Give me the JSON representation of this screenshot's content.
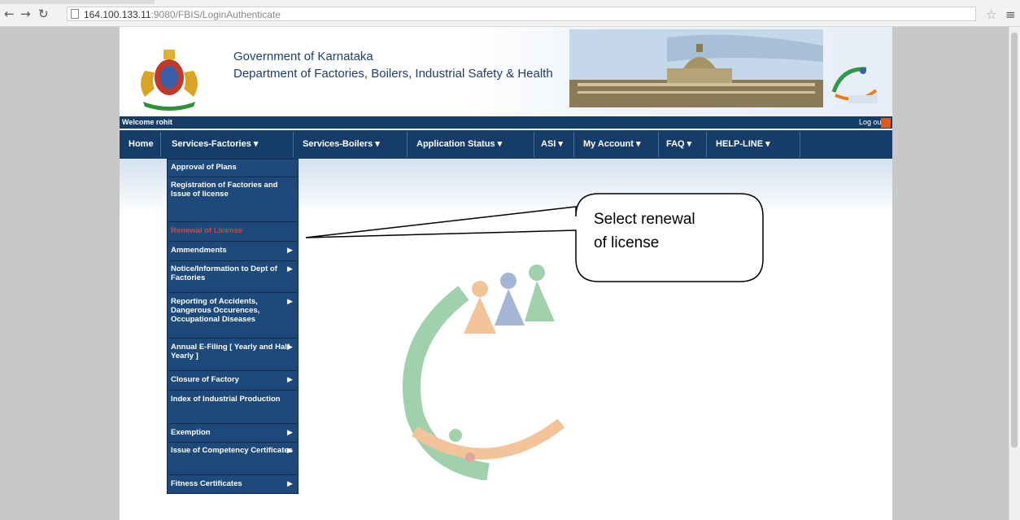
{
  "browser": {
    "url_host": "164.100.133.11",
    "url_path": ":9080/FBIS/LoginAuthenticate"
  },
  "header": {
    "gov_title": "Government of Karnataka",
    "dept_title": "Department of Factories, Boilers, Industrial Safety & Health"
  },
  "welcome": {
    "text": "Welcome rohit",
    "logout": "Log out"
  },
  "nav": {
    "home": "Home",
    "services_factories": "Services-Factories ▾",
    "services_boilers": "Services-Boilers ▾",
    "application_status": "Application Status ▾",
    "asi": "ASI ▾",
    "my_account": "My Account ▾",
    "faq": "FAQ ▾",
    "helpline": "HELP-LINE ▾"
  },
  "dropdown": {
    "approval": "Approval of Plans",
    "registration": "Registration of Factories and Issue of license",
    "renewal": "Renewal of License",
    "ammendments": "Ammendments",
    "notice": "Notice/Information to Dept of Factories",
    "reporting": "Reporting of Accidents, Dangerous Occurences, Occupational Diseases",
    "annual": "Annual E-Filing [ Yearly and Half-Yearly ]",
    "closure": "Closure of Factory",
    "index": "Index of Industrial Production",
    "exemption": "Exemption",
    "competency": "Issue of Competency Certificates",
    "fitness": "Fitness Certificates"
  },
  "callout": {
    "line1": "Select renewal",
    "line2": "of license"
  },
  "colors": {
    "nav_bg": "#163d6a",
    "dropdown_bg": "#1d4a7b",
    "highlight": "#d4453a"
  }
}
